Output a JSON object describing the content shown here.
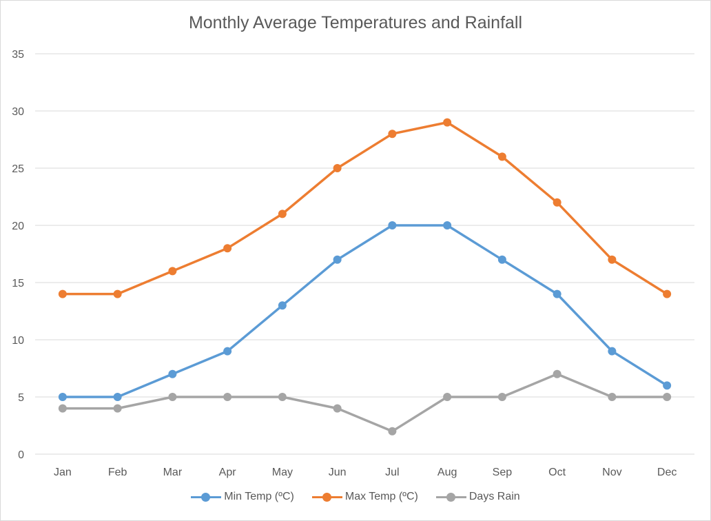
{
  "chart_data": {
    "type": "line",
    "title": "Monthly Average Temperatures and Rainfall",
    "xlabel": "",
    "ylabel": "",
    "categories": [
      "Jan",
      "Feb",
      "Mar",
      "Apr",
      "May",
      "Jun",
      "Jul",
      "Aug",
      "Sep",
      "Oct",
      "Nov",
      "Dec"
    ],
    "ylim": [
      0,
      35
    ],
    "yticks": [
      0,
      5,
      10,
      15,
      20,
      25,
      30,
      35
    ],
    "grid": true,
    "legend_position": "bottom",
    "series": [
      {
        "name": "Min Temp (ºC)",
        "color": "#5b9bd5",
        "values": [
          5,
          5,
          7,
          9,
          13,
          17,
          20,
          20,
          17,
          14,
          9,
          6
        ]
      },
      {
        "name": "Max Temp (ºC)",
        "color": "#ed7d31",
        "values": [
          14,
          14,
          16,
          18,
          21,
          25,
          28,
          29,
          26,
          22,
          17,
          14
        ]
      },
      {
        "name": "Days Rain",
        "color": "#a5a5a5",
        "values": [
          4,
          4,
          5,
          5,
          5,
          4,
          2,
          5,
          5,
          7,
          5,
          5
        ]
      }
    ]
  }
}
